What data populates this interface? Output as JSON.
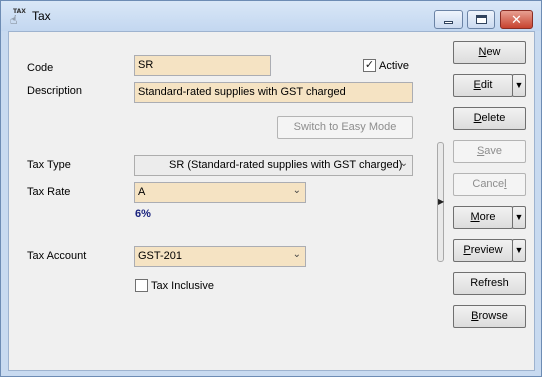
{
  "window": {
    "title": "Tax",
    "icon_caption": "TAX",
    "minimize_icon": "minimize-icon",
    "maximize_icon": "maximize-icon",
    "close_icon": "close-icon",
    "close_glyph": "✕"
  },
  "form": {
    "code_label": "Code",
    "code_value": "SR",
    "active_label": "Active",
    "active_checked": true,
    "description_label": "Description",
    "description_value": "Standard-rated supplies with GST charged",
    "switch_button_label": "Switch to Easy Mode",
    "tax_type_label": "Tax Type",
    "tax_type_value": "SR (Standard-rated supplies with GST charged)",
    "tax_rate_label": "Tax Rate",
    "tax_rate_value": "A",
    "tax_rate_display": "6%",
    "tax_account_label": "Tax Account",
    "tax_account_value": "GST-201",
    "tax_inclusive_label": "Tax Inclusive",
    "tax_inclusive_checked": false,
    "check_glyph": "✓"
  },
  "actions": {
    "new": {
      "u": "N",
      "rest": "ew"
    },
    "edit": {
      "u": "E",
      "rest": "dit"
    },
    "delete": {
      "pre": "",
      "u": "D",
      "rest": "elete"
    },
    "save": {
      "u": "S",
      "rest": "ave"
    },
    "cancel": {
      "pre": "Cance",
      "u": "l"
    },
    "more": {
      "pre": "",
      "u": "M",
      "rest": "ore"
    },
    "preview": {
      "u": "P",
      "rest": "review"
    },
    "refresh": "Refresh",
    "browse": {
      "u": "B",
      "rest": "rowse"
    },
    "dropdown_arrow": "▼",
    "splitter_arrow": "▶",
    "combo_arrow": "⌄"
  },
  "colors": {
    "field_bg": "#f5e3c3",
    "window_bg": "#f0f0f0",
    "rate_text": "#1a237e",
    "close_red": "#c7432f"
  }
}
